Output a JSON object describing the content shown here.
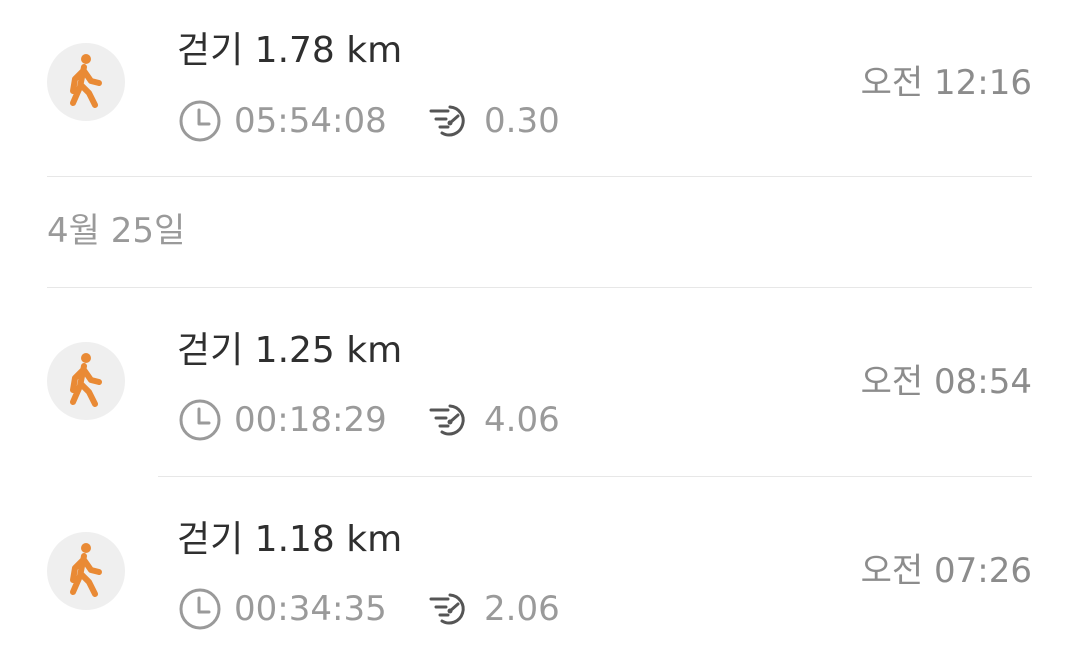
{
  "colors": {
    "accent": "#E98A35",
    "icon_bg": "#EFEFEF",
    "title_text": "#2F2F2F",
    "secondary_text": "#9A9A9A",
    "divider": "#E7E7E7"
  },
  "icons": {
    "activity": "walking-person-icon",
    "duration": "clock-icon",
    "pace": "speedometer-icon"
  },
  "date_header": "4월 25일",
  "activities": [
    {
      "title": "걷기 1.78 km",
      "duration": "05:54:08",
      "pace": "0.30",
      "time": "오전 12:16"
    },
    {
      "title": "걷기 1.25 km",
      "duration": "00:18:29",
      "pace": "4.06",
      "time": "오전 08:54"
    },
    {
      "title": "걷기 1.18 km",
      "duration": "00:34:35",
      "pace": "2.06",
      "time": "오전 07:26"
    }
  ]
}
